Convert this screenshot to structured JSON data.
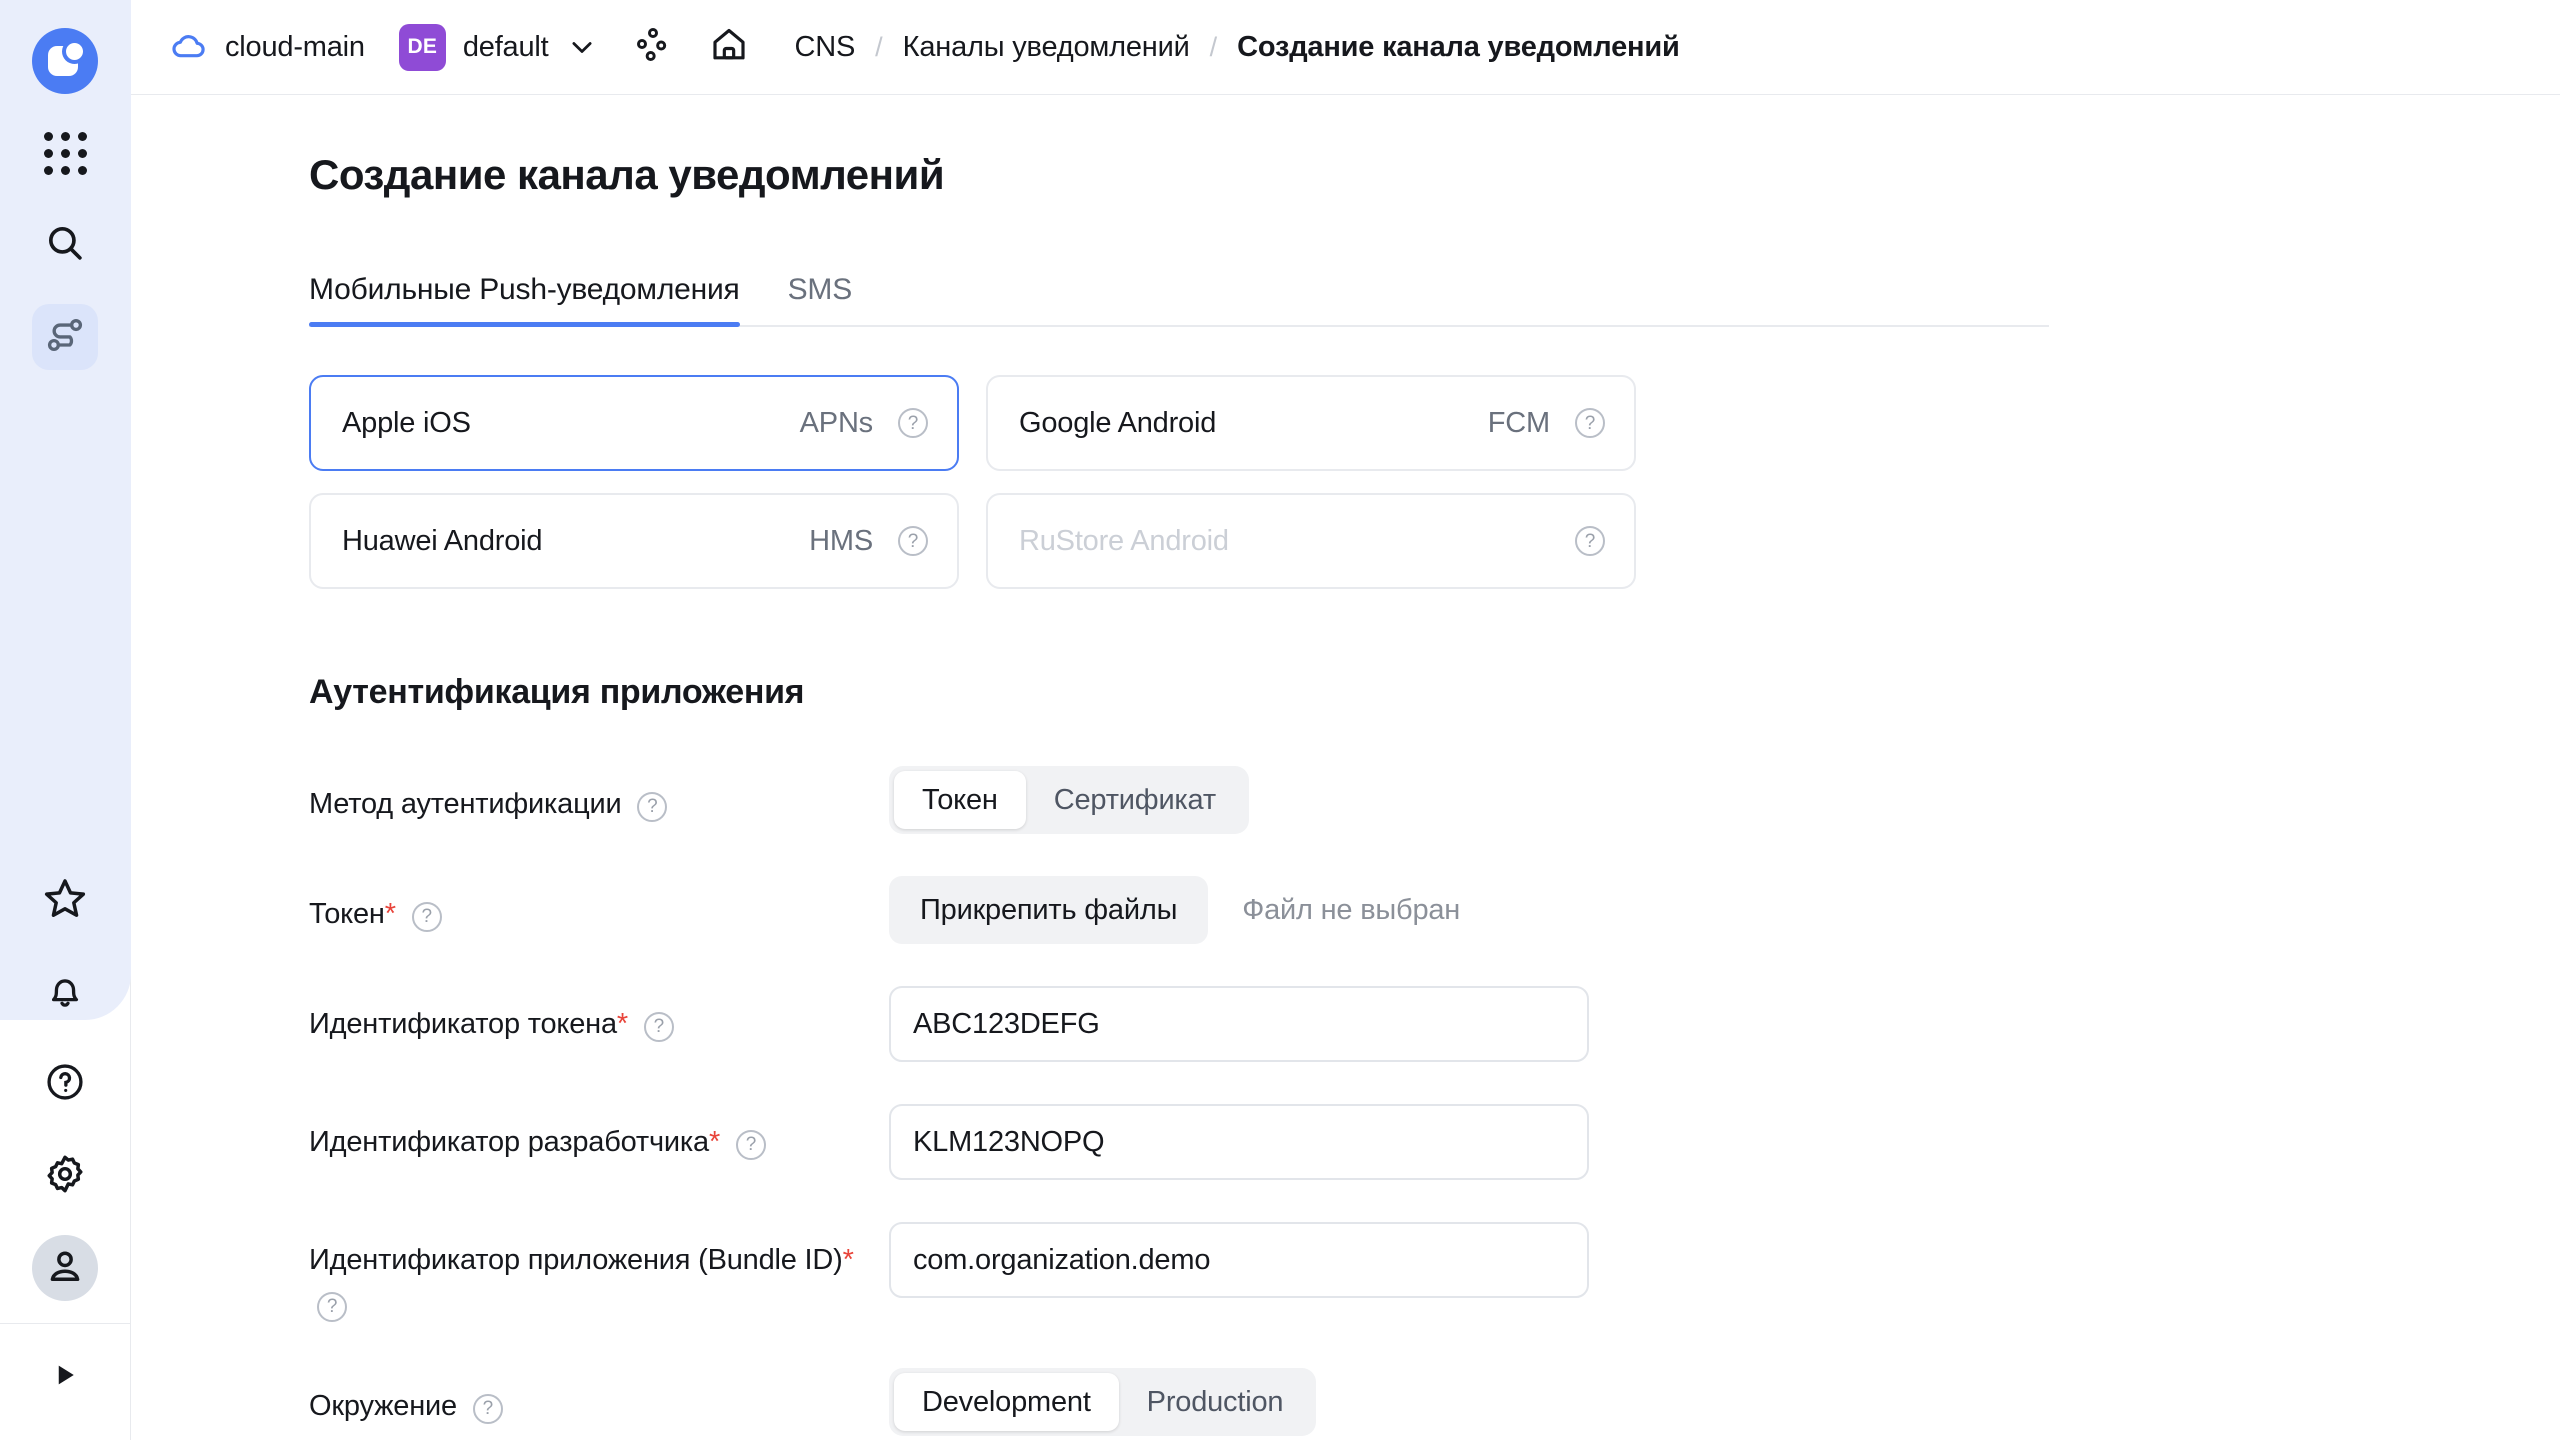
{
  "sidebar": {
    "logo_name": "app-logo",
    "items": [
      {
        "name": "apps-grid-icon"
      },
      {
        "name": "search-icon"
      },
      {
        "name": "topology-icon",
        "active": true
      }
    ],
    "bottom_items": [
      {
        "name": "favorites-star-icon"
      },
      {
        "name": "notifications-bell-icon"
      },
      {
        "name": "help-circle-icon"
      },
      {
        "name": "settings-gear-icon"
      },
      {
        "name": "user-avatar-icon",
        "active": true
      }
    ],
    "expand_label": "expand-panel-icon"
  },
  "topbar": {
    "cloud_name": "cloud-main",
    "project_badge": "DE",
    "project_name": "default",
    "breadcrumbs": [
      {
        "label": "CNS",
        "current": false
      },
      {
        "label": "Каналы уведомлений",
        "current": false
      },
      {
        "label": "Создание канала уведомлений",
        "current": true
      }
    ],
    "separator": "/"
  },
  "page": {
    "title": "Создание канала уведомлений"
  },
  "tabs": [
    {
      "label": "Мобильные Push-уведомления",
      "active": true
    },
    {
      "label": "SMS",
      "active": false
    }
  ],
  "providers": [
    {
      "name": "Apple iOS",
      "badge": "APNs",
      "selected": true,
      "disabled": false,
      "has_help": true
    },
    {
      "name": "Google Android",
      "badge": "FCM",
      "selected": false,
      "disabled": false,
      "has_help": true
    },
    {
      "name": "Huawei Android",
      "badge": "HMS",
      "selected": false,
      "disabled": false,
      "has_help": true
    },
    {
      "name": "RuStore Android",
      "badge": "",
      "selected": false,
      "disabled": true,
      "has_help": true
    }
  ],
  "auth_section": {
    "title": "Аутентификация приложения",
    "method": {
      "label": "Метод аутентификации",
      "required": false,
      "options": [
        "Токен",
        "Сертификат"
      ],
      "selected": "Токен"
    },
    "token_file": {
      "label": "Токен",
      "required": true,
      "button_label": "Прикрепить файлы",
      "status": "Файл не выбран"
    },
    "token_id": {
      "label": "Идентификатор токена",
      "required": true,
      "value": "ABC123DEFG",
      "placeholder": ""
    },
    "developer_id": {
      "label": "Идентификатор разработчика",
      "required": true,
      "value": "KLM123NOPQ",
      "placeholder": ""
    },
    "bundle_id": {
      "label": "Идентификатор приложения (Bundle ID)",
      "required": true,
      "value": "com.organization.demo",
      "placeholder": ""
    },
    "environment": {
      "label": "Окружение",
      "required": false,
      "options": [
        "Development",
        "Production"
      ],
      "selected": "Development"
    }
  },
  "icons": {
    "help": "?"
  },
  "colors": {
    "accent": "#4b7cf3",
    "badge_purple": "#8f4bd6",
    "required_red": "#e8443a",
    "sidebar_bg": "#e9eefb"
  }
}
